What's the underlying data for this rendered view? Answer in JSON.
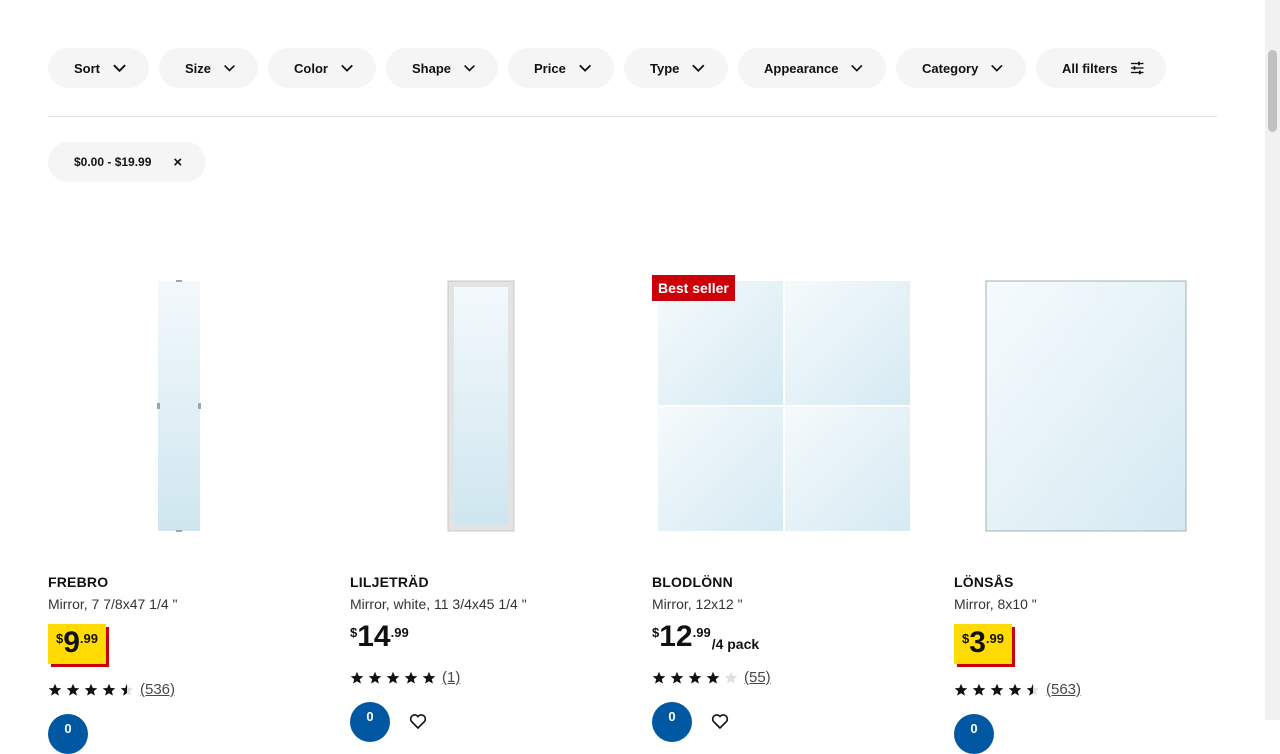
{
  "filters": [
    {
      "label": "Sort",
      "icon": "chevron-down-icon"
    },
    {
      "label": "Size",
      "icon": "chevron-down-icon"
    },
    {
      "label": "Color",
      "icon": "chevron-down-icon"
    },
    {
      "label": "Shape",
      "icon": "chevron-down-icon"
    },
    {
      "label": "Price",
      "icon": "chevron-down-icon"
    },
    {
      "label": "Type",
      "icon": "chevron-down-icon"
    },
    {
      "label": "Appearance",
      "icon": "chevron-down-icon"
    },
    {
      "label": "Category",
      "icon": "chevron-down-icon"
    },
    {
      "label": "All filters",
      "icon": "sliders-icon"
    }
  ],
  "active_filter": {
    "label": "$0.00 - $19.99",
    "remove_icon": "close-icon",
    "remove_glyph": "×"
  },
  "products": [
    {
      "name": "FREBRO",
      "description": "Mirror, 7 7/8x47 1/4 \"",
      "currency": "$",
      "price_int": "9",
      "price_dec": ".99",
      "unit": "",
      "promo": true,
      "badge": "",
      "rating": 4.5,
      "reviews": "(536)",
      "cart_glyph": "0"
    },
    {
      "name": "LILJETRÄD",
      "description": "Mirror, white, 11 3/4x45 1/4 \"",
      "currency": "$",
      "price_int": "14",
      "price_dec": ".99",
      "unit": "",
      "promo": false,
      "badge": "",
      "rating": 5,
      "reviews": "(1)",
      "cart_glyph": "0"
    },
    {
      "name": "BLODLÖNN",
      "description": "Mirror, 12x12 \"",
      "currency": "$",
      "price_int": "12",
      "price_dec": ".99",
      "unit": "/4 pack",
      "promo": false,
      "badge": "Best seller",
      "rating": 4,
      "reviews": "(55)",
      "cart_glyph": "0"
    },
    {
      "name": "LÖNSÅS",
      "description": "Mirror, 8x10 \"",
      "currency": "$",
      "price_int": "3",
      "price_dec": ".99",
      "unit": "",
      "promo": true,
      "badge": "",
      "rating": 4.5,
      "reviews": "(563)",
      "cart_glyph": "0"
    }
  ],
  "colors": {
    "promo_yellow": "#ffdb00",
    "promo_red": "#cc0008",
    "badge_bg": "#cc0008",
    "cart_blue": "#0058a3",
    "pill_bg": "#f5f5f5"
  }
}
